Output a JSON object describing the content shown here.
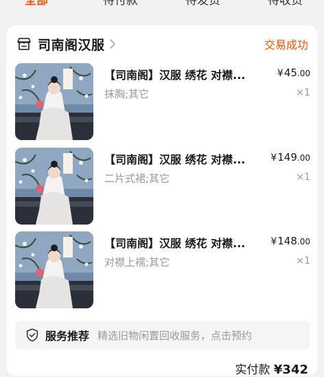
{
  "tabs": [
    {
      "label": "全部",
      "active": true
    },
    {
      "label": "待付款",
      "active": false
    },
    {
      "label": "待发货",
      "active": false
    },
    {
      "label": "待收货",
      "active": false
    }
  ],
  "order": {
    "shop_name": "司南阁汉服",
    "status": "交易成功",
    "items": [
      {
        "title": "【司南阁】汉服 绣花 对襟...",
        "spec": "抹胸;其它",
        "price_currency": "¥",
        "price_int": "45",
        "price_dec": ".00",
        "qty": "×1"
      },
      {
        "title": "【司南阁】汉服 绣花 对襟...",
        "spec": "二片式裙;其它",
        "price_currency": "¥",
        "price_int": "149",
        "price_dec": ".00",
        "qty": "×1"
      },
      {
        "title": "【司南阁】汉服 绣花 对襟...",
        "spec": "对襟上襦;其它",
        "price_currency": "¥",
        "price_int": "148",
        "price_dec": ".00",
        "qty": "×1"
      }
    ],
    "service": {
      "label": "服务推荐",
      "description": "精选旧物闲置回收服务，点击预约"
    },
    "paid_label": "实付款",
    "paid_currency": "¥",
    "paid_amount": "342"
  },
  "colors": {
    "accent": "#ff5000",
    "muted": "#999999",
    "background": "#f2f2f2"
  }
}
